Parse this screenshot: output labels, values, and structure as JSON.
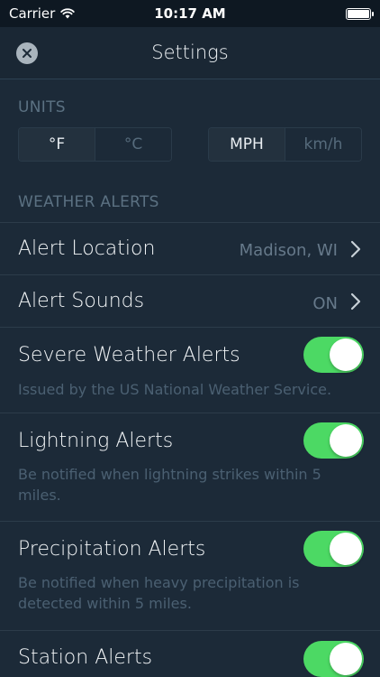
{
  "status_bar": {
    "carrier": "Carrier",
    "time": "10:17 AM",
    "battery_level": 1.0
  },
  "nav": {
    "title": "Settings",
    "close_icon": "close-x-icon"
  },
  "units": {
    "header": "UNITS",
    "temperature": {
      "options": [
        "°F",
        "°C"
      ],
      "selected": "°F"
    },
    "speed": {
      "options": [
        "MPH",
        "km/h"
      ],
      "selected": "MPH"
    }
  },
  "weather_alerts": {
    "header": "WEATHER ALERTS",
    "alert_location": {
      "label": "Alert Location",
      "value": "Madison, WI"
    },
    "alert_sounds": {
      "label": "Alert Sounds",
      "value": "ON"
    },
    "severe": {
      "label": "Severe Weather Alerts",
      "description": "Issued by the US National Weather Service.",
      "enabled": true
    },
    "lightning": {
      "label": "Lightning Alerts",
      "description": "Be notified when lightning strikes within 5 miles.",
      "enabled": true
    },
    "precipitation": {
      "label": "Precipitation Alerts",
      "description": "Be notified when heavy precipitation is detected within 5 miles.",
      "enabled": true
    },
    "station": {
      "label": "Station Alerts",
      "enabled": true
    }
  },
  "colors": {
    "background": "#1c2a38",
    "toggle_on": "#4cd964",
    "header_text": "#5b7182"
  }
}
